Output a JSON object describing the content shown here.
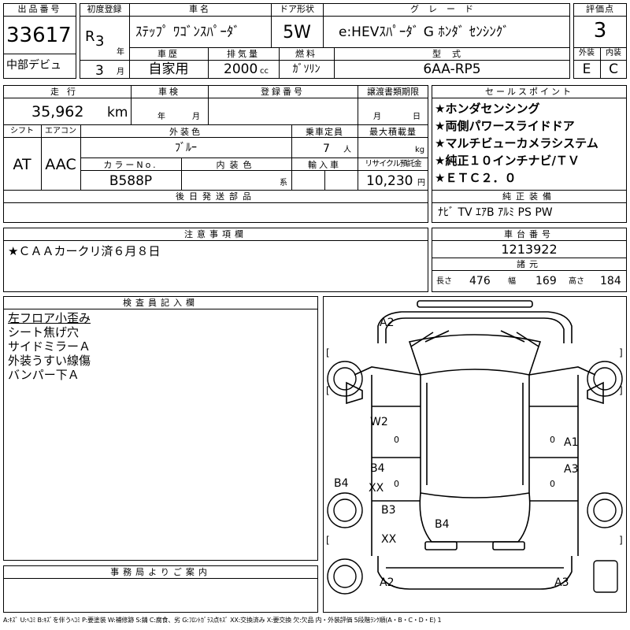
{
  "header": {
    "lot_label": "出品番号",
    "lot_no": "33617",
    "reg_label": "初度登録",
    "era": "R",
    "era_year": "3",
    "year_unit": "年",
    "reg_month": "3",
    "month_unit": "月",
    "name_label": "車名",
    "name": "ｽﾃｯﾌﾟ ﾜｺﾞﾝｽﾊﾟｰﾀﾞ",
    "door_label": "ドア形状",
    "door": "5W",
    "grade_label": "グレード",
    "grade": "e:HEVｽﾊﾟｰﾀﾞ G ﾎﾝﾀﾞ ｾﾝｼﾝｸﾞ",
    "score_label": "評価点",
    "score": "3",
    "debut": "中部デビュ",
    "history_label": "車歴",
    "history": "自家用",
    "displacement_label": "排気量",
    "displacement": "2000",
    "displacement_unit": "cc",
    "fuel_label": "燃料",
    "fuel": "ｶﾞｿﾘﾝ",
    "model_label": "型式",
    "model": "6AA-RP5",
    "ext_label": "外装",
    "ext_grade": "E",
    "int_label": "内装",
    "int_grade": "C"
  },
  "details": {
    "mileage_label": "走行",
    "mileage": "35,962",
    "mileage_unit": "km",
    "inspection_label": "車検",
    "year_unit": "年",
    "month_unit": "月",
    "plate_label": "登録番号",
    "transfer_label": "譲渡書類期限",
    "transfer_month": "月",
    "transfer_day": "日",
    "shift_label": "シフト",
    "shift": "AT",
    "ac_label": "エアコン",
    "ac": "AAC",
    "color_label": "外装色",
    "color": "ﾌﾞﾙｰ",
    "capacity_label": "乗車定員",
    "capacity": "7",
    "capacity_unit": "人",
    "load_label": "最大積載量",
    "load_unit": "kg",
    "color_no_label": "カラーNo.",
    "color_no": "B588P",
    "int_color_label": "内装色",
    "int_color_unit": "系",
    "import_label": "輸入車",
    "recycle_label": "リサイクル預託金",
    "recycle": "10,230",
    "recycle_unit": "円",
    "later_parts_label": "後日発送部品"
  },
  "sales_points": {
    "title": "セールスポイント",
    "items": [
      "★ホンダセンシング",
      "★両側パワースライドドア",
      "★マルチビューカメラシステム",
      "★純正１０インチナビ/ＴＶ",
      "★ＥＴＣ２．０"
    ]
  },
  "equipment": {
    "label": "純正装備",
    "value": "ﾅﾋﾞ TV ｴｱB ｱﾙﾐ PS PW"
  },
  "notes": {
    "label": "注意事項欄",
    "text": "★ＣＡＡカークリ済６月８日"
  },
  "chassis": {
    "label": "車台番号",
    "number": "1213922",
    "dims_label": "諸元",
    "length_label": "長さ",
    "length": "476",
    "width_label": "幅",
    "width": "169",
    "height_label": "高さ",
    "height": "184"
  },
  "inspector": {
    "label": "検査員記入欄",
    "lines": [
      "左フロア小歪み",
      "シート焦げ穴",
      "サイドミラーＡ",
      "外装うすい線傷",
      "バンパー下Ａ"
    ]
  },
  "office": {
    "label": "事務局よりご案内"
  },
  "diagram": {
    "marks": {
      "a2_top": "A2",
      "w2": "W2",
      "a1": "A1",
      "a3_right": "A3",
      "b4_left": "B4",
      "b4_door": "B4",
      "xx_upper": "XX",
      "b3": "B3",
      "xx_lower": "XX",
      "b4_rear": "B4",
      "a2_bottom": "A2",
      "a3_bottom": "A3"
    },
    "zero": "0",
    "bracket_open": "[",
    "bracket_close": "]"
  },
  "legend": "A:ｷｽﾞ U:ﾍｺﾐ B:ｷｽﾞを伴うﾍｺﾐ P:要塗装 W:補修跡 S:錆 C:腐食、劣 G:ﾌﾛﾝﾄｶﾞﾗｽ点ｷｽﾞ XX:交換済み X:要交換 欠:欠品 内・外装評価 5段階ﾗﾝｸ順(A・B・C・D・E) 1"
}
